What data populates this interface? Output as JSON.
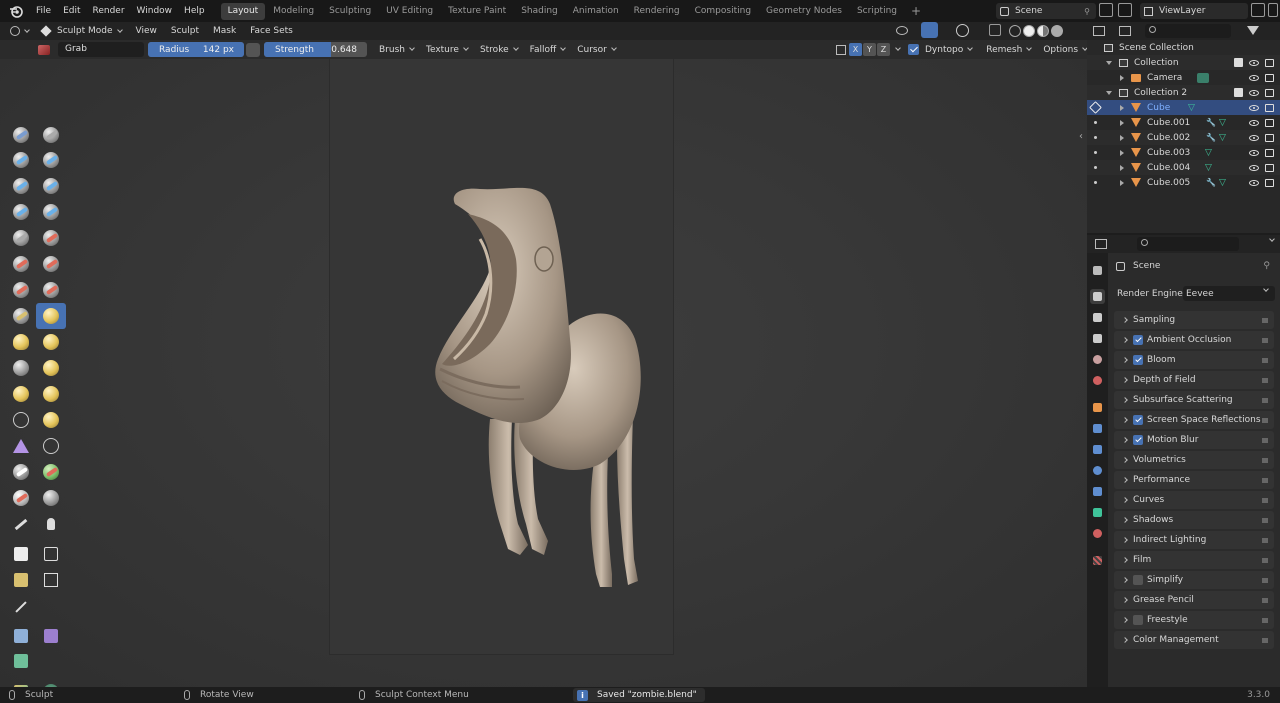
{
  "topbar": {
    "menu": [
      "File",
      "Edit",
      "Render",
      "Window",
      "Help"
    ],
    "workspaces": [
      "Layout",
      "Modeling",
      "Sculpting",
      "UV Editing",
      "Texture Paint",
      "Shading",
      "Animation",
      "Rendering",
      "Compositing",
      "Geometry Nodes",
      "Scripting"
    ],
    "active_workspace": "Layout",
    "scene": "Scene",
    "view_layer": "ViewLayer"
  },
  "viewport_header": {
    "mode": "Sculpt Mode",
    "menus": [
      "View",
      "Sculpt",
      "Mask",
      "Face Sets"
    ]
  },
  "tool_settings": {
    "brush_name": "Grab",
    "radius_label": "Radius",
    "radius_value": "142 px",
    "strength_label": "Strength",
    "strength_value": "0.648",
    "strength_fraction": 0.648,
    "dropdowns": [
      "Brush",
      "Texture",
      "Stroke",
      "Falloff",
      "Cursor"
    ],
    "axes": [
      "X",
      "Y",
      "Z"
    ],
    "dyntopo": "Dyntopo",
    "remesh": "Remesh",
    "options": "Options"
  },
  "outliner": {
    "root": "Scene Collection",
    "items": [
      {
        "label": "Collection",
        "type": "collection"
      },
      {
        "label": "Camera",
        "type": "camera"
      },
      {
        "label": "Collection 2",
        "type": "collection"
      },
      {
        "label": "Cube",
        "type": "mesh",
        "selected": true
      },
      {
        "label": "Cube.001",
        "type": "mesh"
      },
      {
        "label": "Cube.002",
        "type": "mesh"
      },
      {
        "label": "Cube.003",
        "type": "mesh"
      },
      {
        "label": "Cube.004",
        "type": "mesh"
      },
      {
        "label": "Cube.005",
        "type": "mesh"
      }
    ]
  },
  "properties": {
    "context": "Scene",
    "render_engine_label": "Render Engine",
    "render_engine": "Eevee",
    "panels": [
      {
        "label": "Sampling"
      },
      {
        "label": "Ambient Occlusion",
        "checkbox": true
      },
      {
        "label": "Bloom",
        "checkbox": true
      },
      {
        "label": "Depth of Field"
      },
      {
        "label": "Subsurface Scattering"
      },
      {
        "label": "Screen Space Reflections",
        "checkbox": true
      },
      {
        "label": "Motion Blur",
        "checkbox": true
      },
      {
        "label": "Volumetrics"
      },
      {
        "label": "Performance"
      },
      {
        "label": "Curves"
      },
      {
        "label": "Shadows"
      },
      {
        "label": "Indirect Lighting"
      },
      {
        "label": "Film"
      },
      {
        "label": "Simplify",
        "checkbox": false
      },
      {
        "label": "Grease Pencil"
      },
      {
        "label": "Freestyle",
        "checkbox": false
      },
      {
        "label": "Color Management"
      }
    ]
  },
  "statusbar": {
    "left": "Sculpt",
    "middle": "Rotate View",
    "context": "Sculpt Context Menu",
    "message": "Saved \"zombie.blend\"",
    "version": "3.3.0"
  },
  "colors": {
    "accent": "#4772b3",
    "selection": "#334d80",
    "mesh_orange": "#e8954a",
    "vertex_green": "#3fc49a"
  }
}
